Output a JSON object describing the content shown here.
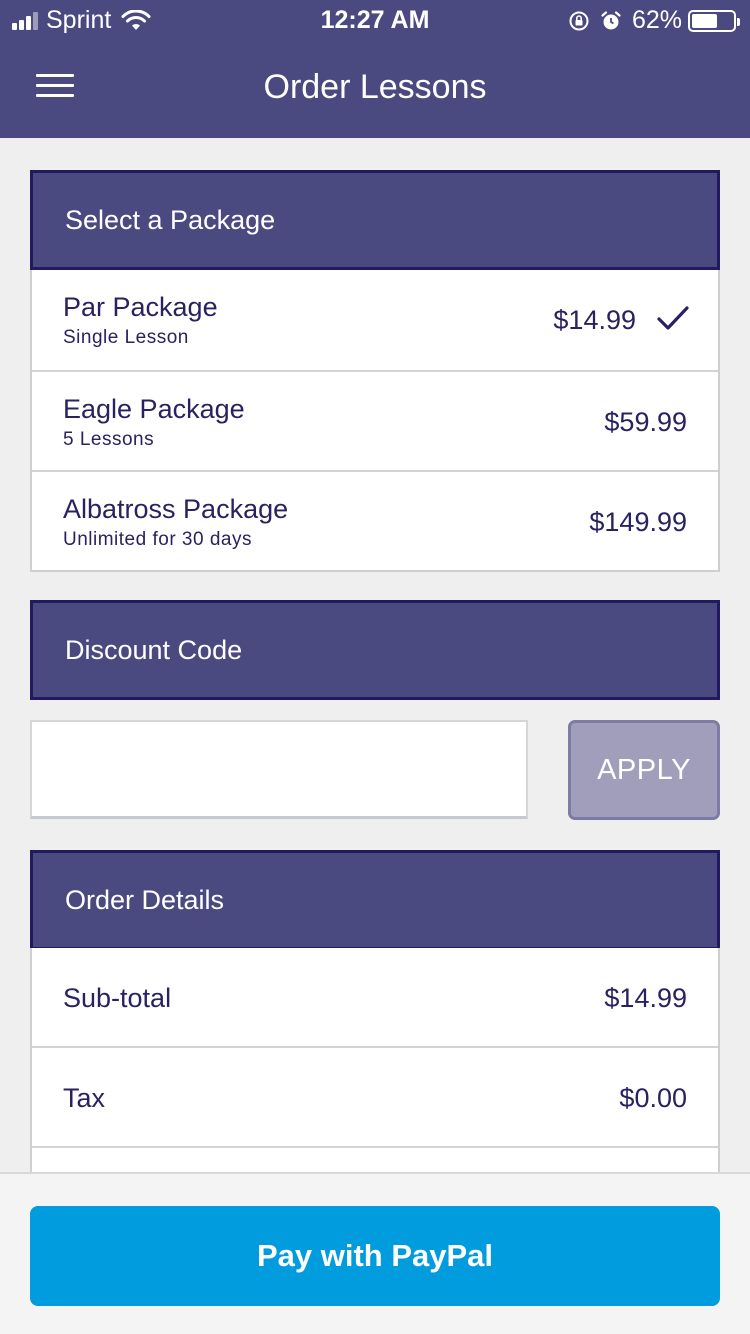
{
  "status_bar": {
    "carrier": "Sprint",
    "time": "12:27 AM",
    "battery_percent": "62%",
    "battery_level": 0.62,
    "icons": [
      "signal-icon",
      "wifi-icon",
      "orientation-lock-icon",
      "alarm-icon",
      "battery-icon"
    ]
  },
  "header": {
    "title": "Order Lessons",
    "menu_icon": "hamburger-menu-icon"
  },
  "packages": {
    "heading": "Select a Package",
    "items": [
      {
        "name": "Par Package",
        "subtitle": "Single Lesson",
        "price": "$14.99",
        "selected": true
      },
      {
        "name": "Eagle Package",
        "subtitle": "5 Lessons",
        "price": "$59.99",
        "selected": false
      },
      {
        "name": "Albatross Package",
        "subtitle": "Unlimited for 30 days",
        "price": "$149.99",
        "selected": false
      }
    ]
  },
  "discount": {
    "heading": "Discount Code",
    "input_value": "",
    "input_placeholder": "",
    "apply_label": "APPLY"
  },
  "order_details": {
    "heading": "Order Details",
    "rows": [
      {
        "label": "Sub-total",
        "value": "$14.99"
      },
      {
        "label": "Tax",
        "value": "$0.00"
      }
    ]
  },
  "pay": {
    "label": "Pay with PayPal"
  },
  "colors": {
    "header_bg": "#4b4a80",
    "header_border": "#211a5e",
    "text": "#2a2260",
    "apply_bg": "#a09eba",
    "paypal_blue": "#009cde",
    "page_bg": "#efefef"
  }
}
